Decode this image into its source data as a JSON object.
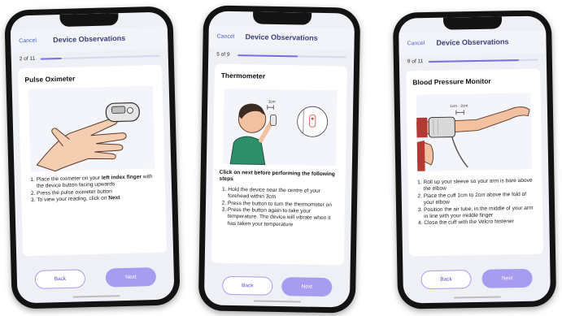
{
  "colors": {
    "accent": "#7b6fe0",
    "button_fill": "#a89cf0",
    "cancel": "#4c63c4",
    "title": "#3a3f7a"
  },
  "phones": [
    {
      "header": {
        "cancel": "Cancel",
        "title": "Device Observations"
      },
      "progress": {
        "label": "2 of 11",
        "fraction": 0.18
      },
      "card_title": "Pulse Oximeter",
      "illustration_icon": "pulse-oximeter-on-finger",
      "lead": "",
      "steps": [
        "Place the oximeter on your ",
        "left index finger",
        " with the device button facing upwards",
        "Press the pulse oximeter button",
        "To view your reading, click on ",
        "Next"
      ],
      "buttons": {
        "back": "Back",
        "next": "Next"
      }
    },
    {
      "header": {
        "cancel": "Cancel",
        "title": "Device Observations"
      },
      "progress": {
        "label": "5 of 9",
        "fraction": 0.56
      },
      "card_title": "Thermometer",
      "illustration_icon": "forehead-thermometer",
      "illustration_text": "3cm",
      "lead": "Click on next before performing the following steps",
      "steps": [
        "Hold the device near the centre of your forehead within 3cm",
        "Press the button to turn the thermometer on",
        "Press the button again to take your temperature. The device will vibrate when it has taken your temperature"
      ],
      "buttons": {
        "back": "Back",
        "next": "Next"
      }
    },
    {
      "header": {
        "cancel": "Cancel",
        "title": "Device Observations"
      },
      "progress": {
        "label": "9 of 11",
        "fraction": 0.82
      },
      "card_title": "Blood Pressure Monitor",
      "illustration_icon": "blood-pressure-cuff-on-arm",
      "illustration_text": "1cm - 2cm",
      "lead": "",
      "steps": [
        "Roll up your sleeve so your arm is bare above the elbow",
        "Place the cuff 1cm to 2cm above the fold of your elbow",
        "Position the air tube, in the middle of your arm in line with your middle finger",
        "Close the cuff with the Velcro fastener"
      ],
      "buttons": {
        "back": "Back",
        "next": "Next"
      }
    }
  ]
}
